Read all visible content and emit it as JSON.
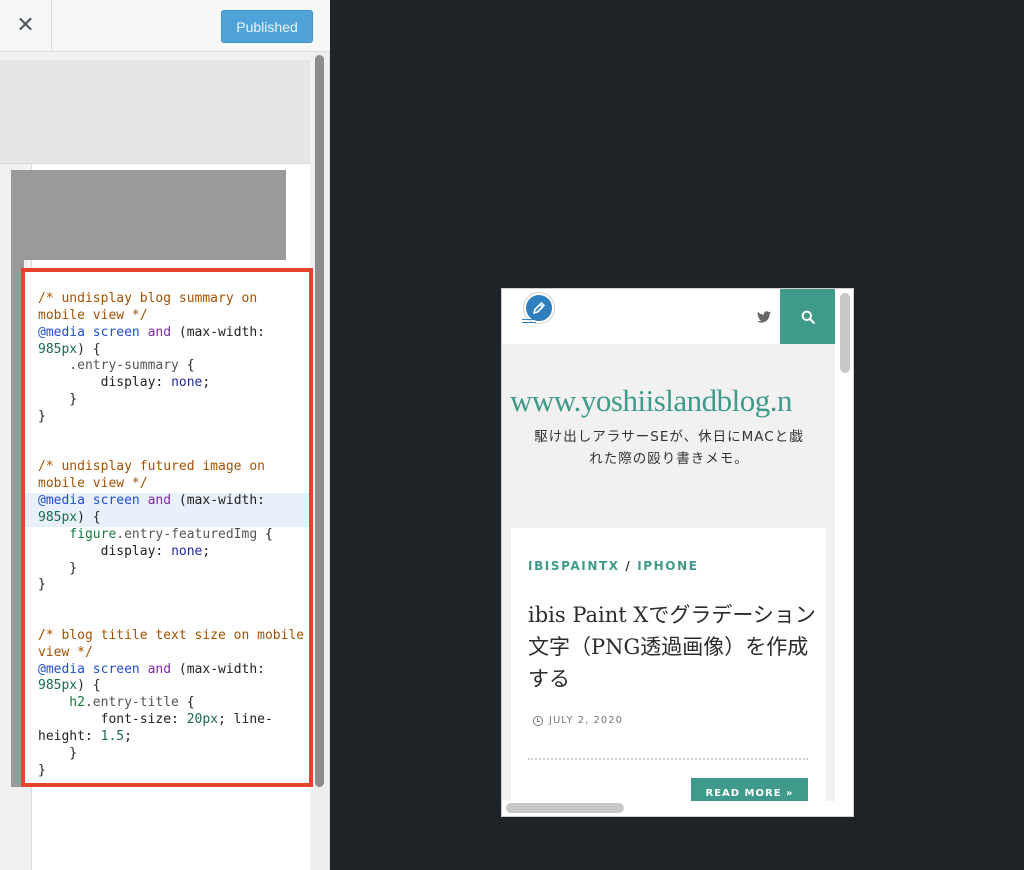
{
  "toolbar": {
    "close_glyph": "✕",
    "publish_label": "Published"
  },
  "editor": {
    "lines": [
      [
        {
          "t": "/* undisplay blog summary on",
          "c": "c-comment"
        }
      ],
      [
        {
          "t": "mobile view */",
          "c": "c-comment"
        }
      ],
      [
        {
          "t": "@media",
          "c": "c-at"
        },
        {
          "t": " ",
          "c": ""
        },
        {
          "t": "screen",
          "c": "c-at"
        },
        {
          "t": " ",
          "c": ""
        },
        {
          "t": "and",
          "c": "c-kw"
        },
        {
          "t": " (max-width:",
          "c": "c-prop"
        }
      ],
      [
        {
          "t": "985px",
          "c": "c-num"
        },
        {
          "t": ") {",
          "c": "c-prop"
        }
      ],
      [
        {
          "t": "    .entry-summary",
          "c": "c-sel"
        },
        {
          "t": " {",
          "c": "c-prop"
        }
      ],
      [
        {
          "t": "        display: ",
          "c": "c-prop"
        },
        {
          "t": "none",
          "c": "c-val"
        },
        {
          "t": ";",
          "c": "c-prop"
        }
      ],
      [
        {
          "t": "    }",
          "c": "c-prop"
        }
      ],
      [
        {
          "t": "}",
          "c": "c-prop"
        }
      ],
      [],
      [],
      [
        {
          "t": "/* undisplay futured image on",
          "c": "c-comment"
        }
      ],
      [
        {
          "t": "mobile view */",
          "c": "c-comment"
        }
      ],
      [
        {
          "t": "@media",
          "c": "c-at"
        },
        {
          "t": " ",
          "c": ""
        },
        {
          "t": "screen",
          "c": "c-at"
        },
        {
          "t": " ",
          "c": ""
        },
        {
          "t": "and",
          "c": "c-kw"
        },
        {
          "t": " (max-width:",
          "c": "c-prop"
        }
      ],
      [
        {
          "t": "985px",
          "c": "c-num"
        },
        {
          "t": ") {",
          "c": "c-prop"
        }
      ],
      [
        {
          "t": "    figure",
          "c": "c-tag"
        },
        {
          "t": ".entry-featuredImg",
          "c": "c-sel"
        },
        {
          "t": " {",
          "c": "c-prop"
        }
      ],
      [
        {
          "t": "        display: ",
          "c": "c-prop"
        },
        {
          "t": "none",
          "c": "c-val"
        },
        {
          "t": ";",
          "c": "c-prop"
        }
      ],
      [
        {
          "t": "    }",
          "c": "c-prop"
        }
      ],
      [
        {
          "t": "}",
          "c": "c-prop"
        }
      ],
      [],
      [],
      [
        {
          "t": "/* blog titile text size on mobile",
          "c": "c-comment"
        }
      ],
      [
        {
          "t": "view */",
          "c": "c-comment"
        }
      ],
      [
        {
          "t": "@media",
          "c": "c-at"
        },
        {
          "t": " ",
          "c": ""
        },
        {
          "t": "screen",
          "c": "c-at"
        },
        {
          "t": " ",
          "c": ""
        },
        {
          "t": "and",
          "c": "c-kw"
        },
        {
          "t": " (max-width:",
          "c": "c-prop"
        }
      ],
      [
        {
          "t": "985px",
          "c": "c-num"
        },
        {
          "t": ") {",
          "c": "c-prop"
        }
      ],
      [
        {
          "t": "    h2",
          "c": "c-tag"
        },
        {
          "t": ".entry-title",
          "c": "c-sel"
        },
        {
          "t": " {",
          "c": "c-prop"
        }
      ],
      [
        {
          "t": "        font-size: ",
          "c": "c-prop"
        },
        {
          "t": "20px",
          "c": "c-num"
        },
        {
          "t": "; line-",
          "c": "c-prop"
        }
      ],
      [
        {
          "t": "height: ",
          "c": "c-prop"
        },
        {
          "t": "1.5",
          "c": "c-num"
        },
        {
          "t": ";",
          "c": "c-prop"
        }
      ],
      [
        {
          "t": "    }",
          "c": "c-prop"
        }
      ],
      [
        {
          "t": "}",
          "c": "c-prop"
        }
      ]
    ],
    "highlighted_lines": [
      12,
      13
    ]
  },
  "preview": {
    "site_title": "www.yoshiislandblog.n",
    "tagline_line1": "駆け出しアラサーSEが、休日にMACと戯",
    "tagline_line2": "れた際の殴り書きメモ。",
    "post": {
      "category_1": "IBISPAINTX",
      "category_sep": " / ",
      "category_2": "IPHONE",
      "title": "ibis Paint Xでグラデーション文字（PNG透過画像）を作成する",
      "date": "JULY 2, 2020",
      "read_more": "READ MORE »"
    }
  },
  "colors": {
    "accent_teal": "#3f9a8b",
    "publish_blue": "#4fa3d9",
    "highlight_red": "#e8412c",
    "canvas_dark": "#1d2327"
  },
  "icons": [
    "close-icon",
    "edit-pencil-icon",
    "twitter-icon",
    "search-icon",
    "clock-icon"
  ]
}
